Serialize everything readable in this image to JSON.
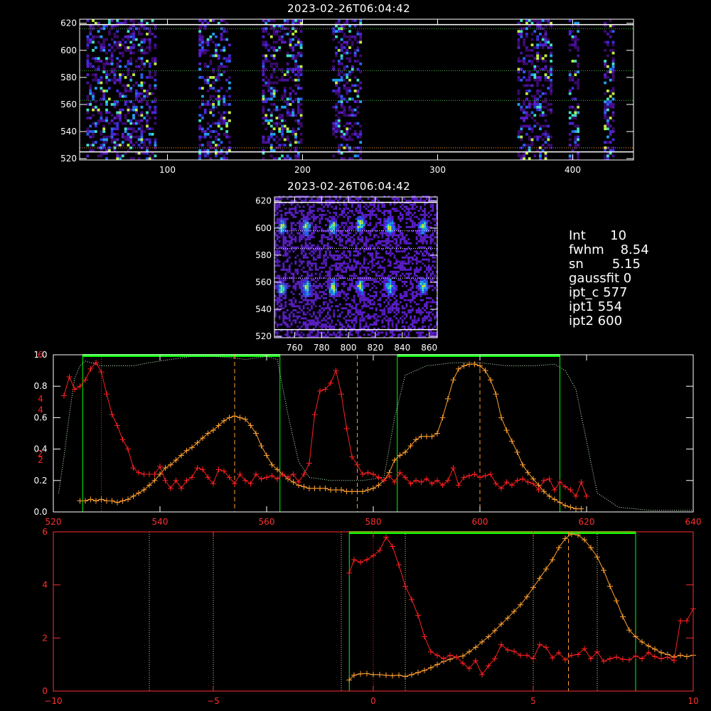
{
  "timestamp_top": "2023-02-26T06:04:42",
  "timestamp_mid": "2023-02-26T06:04:42",
  "info": [
    {
      "key": "Int",
      "val": "10"
    },
    {
      "key": "fwhm",
      "val": "8.54"
    },
    {
      "key": "sn",
      "val": "5.15"
    },
    {
      "key": "gaussfit",
      "val": "0"
    },
    {
      "key": "ipt_c",
      "val": "577"
    },
    {
      "key": "ipt1",
      "val": "554"
    },
    {
      "key": "ipt2",
      "val": "600"
    }
  ],
  "colors": {
    "background": "#000000",
    "axis": "#ffffff",
    "red": "#ff2020",
    "orange": "#ffa030",
    "green": "#00ff00",
    "lightgreen": "#c8ffc8",
    "grid_dotted_green": "#40c040",
    "grid_dotted_yellow": "#d8d890",
    "bottom_axis": "#ff3030"
  },
  "chart_data": [
    {
      "type": "heatmap",
      "title": "2023-02-26T06:04:42",
      "xlim": [
        35,
        445
      ],
      "ylim": [
        519,
        623
      ],
      "xticks": [
        100,
        200,
        300,
        400
      ],
      "yticks": [
        520,
        540,
        560,
        580,
        600,
        620
      ],
      "bands_x": [
        [
          40,
          92
        ],
        [
          123,
          146
        ],
        [
          170,
          200
        ],
        [
          222,
          243
        ],
        [
          359,
          384
        ],
        [
          397,
          405
        ],
        [
          423,
          430
        ]
      ],
      "hlines_white": [
        525,
        619
      ],
      "hlines_green_dotted": [
        563,
        585,
        616
      ],
      "hlines_orange_dotted": [
        528
      ]
    },
    {
      "type": "heatmap",
      "title": "2023-02-26T06:04:42",
      "xlim": [
        745,
        866
      ],
      "ylim": [
        519,
        623
      ],
      "xticks": [
        760,
        780,
        800,
        820,
        840,
        860
      ],
      "yticks": [
        520,
        540,
        560,
        580,
        600,
        620
      ],
      "spots": [
        [
          750,
          600
        ],
        [
          768,
          600
        ],
        [
          788,
          600
        ],
        [
          808,
          602
        ],
        [
          830,
          600
        ],
        [
          855,
          600
        ],
        [
          750,
          555
        ],
        [
          768,
          555
        ],
        [
          788,
          555
        ],
        [
          808,
          556
        ],
        [
          830,
          556
        ],
        [
          855,
          556
        ]
      ],
      "hlines": [
        525,
        619,
        563,
        585,
        598
      ]
    },
    {
      "type": "line",
      "xlim": [
        520,
        640
      ],
      "ylim": [
        0,
        1.0
      ],
      "xticks": [
        520,
        540,
        560,
        580,
        600,
        620,
        640
      ],
      "yticks_left": [
        "0.0",
        "0.2",
        "0.4",
        "0.6",
        "0.8",
        "1.0"
      ],
      "yticks_red": [
        "2",
        "2",
        "4",
        "4",
        "6"
      ],
      "green_boxes": [
        [
          525.5,
          562.5
        ],
        [
          584.5,
          615
        ]
      ],
      "vlines_orange_dashed": [
        554,
        577,
        600
      ],
      "vline_red_dotted": [
        529
      ],
      "series": [
        {
          "x": [
            521,
            522,
            523,
            524,
            525,
            526,
            527,
            528,
            529,
            530,
            532,
            535,
            538,
            542,
            546,
            550,
            554,
            556,
            558,
            560,
            562,
            564,
            566,
            568,
            572,
            576,
            578,
            580,
            582,
            584,
            586,
            590,
            595,
            600,
            605,
            610,
            614,
            616,
            618,
            620,
            622,
            626,
            632,
            640
          ],
          "values": [
            0.12,
            0.35,
            0.62,
            0.85,
            0.93,
            0.96,
            0.95,
            0.94,
            0.93,
            0.93,
            0.93,
            0.93,
            0.95,
            0.97,
            0.99,
            0.99,
            0.98,
            0.97,
            0.98,
            0.99,
            0.97,
            0.62,
            0.32,
            0.22,
            0.2,
            0.2,
            0.2,
            0.21,
            0.22,
            0.6,
            0.87,
            0.93,
            0.95,
            0.95,
            0.93,
            0.93,
            0.94,
            0.9,
            0.78,
            0.45,
            0.12,
            0.03,
            0.01,
            0.01
          ]
        },
        {
          "x": [
            525,
            526,
            527,
            528,
            529,
            530,
            531,
            532,
            533,
            534,
            535,
            536,
            537,
            538,
            539,
            540,
            541,
            542,
            543,
            544,
            545,
            546,
            547,
            548,
            549,
            550,
            551,
            552,
            553,
            554,
            555,
            556,
            557,
            558,
            559,
            560,
            561,
            562,
            563,
            564,
            565,
            566,
            567,
            568,
            569,
            570,
            571,
            572,
            573,
            574,
            575,
            576,
            577,
            578,
            579,
            580,
            581,
            582,
            583,
            584,
            585,
            586,
            587,
            588,
            589,
            590,
            591,
            592,
            593,
            594,
            595,
            596,
            597,
            598,
            599,
            600,
            601,
            602,
            603,
            604,
            605,
            606,
            607,
            608,
            609,
            610,
            611,
            612,
            613,
            614,
            615,
            616,
            617,
            618,
            619
          ],
          "values": [
            0.07,
            0.07,
            0.08,
            0.07,
            0.08,
            0.07,
            0.07,
            0.06,
            0.07,
            0.08,
            0.1,
            0.12,
            0.14,
            0.17,
            0.2,
            0.24,
            0.28,
            0.3,
            0.33,
            0.36,
            0.39,
            0.41,
            0.44,
            0.47,
            0.5,
            0.52,
            0.55,
            0.58,
            0.6,
            0.61,
            0.6,
            0.59,
            0.55,
            0.5,
            0.42,
            0.36,
            0.3,
            0.27,
            0.24,
            0.21,
            0.19,
            0.17,
            0.16,
            0.15,
            0.15,
            0.15,
            0.15,
            0.14,
            0.14,
            0.14,
            0.13,
            0.13,
            0.13,
            0.13,
            0.14,
            0.15,
            0.17,
            0.2,
            0.25,
            0.33,
            0.36,
            0.38,
            0.42,
            0.46,
            0.48,
            0.48,
            0.48,
            0.5,
            0.6,
            0.72,
            0.84,
            0.91,
            0.93,
            0.94,
            0.94,
            0.93,
            0.9,
            0.84,
            0.75,
            0.6,
            0.52,
            0.45,
            0.38,
            0.3,
            0.25,
            0.21,
            0.17,
            0.13,
            0.1,
            0.08,
            0.06,
            0.04,
            0.03,
            0.02,
            0.02
          ]
        },
        {
          "x": [
            522,
            523,
            524,
            525,
            526,
            527,
            528,
            529,
            530,
            531,
            532,
            533,
            534,
            535,
            536,
            537,
            538,
            539,
            540,
            541,
            542,
            543,
            544,
            545,
            546,
            547,
            548,
            549,
            550,
            551,
            552,
            553,
            554,
            555,
            556,
            557,
            558,
            559,
            560,
            561,
            562,
            563,
            564,
            565,
            566,
            567,
            568,
            569,
            570,
            571,
            572,
            573,
            574,
            575,
            576,
            577,
            578,
            579,
            580,
            581,
            582,
            583,
            584,
            585,
            586,
            587,
            588,
            589,
            590,
            591,
            592,
            593,
            594,
            595,
            596,
            597,
            598,
            599,
            600,
            601,
            602,
            603,
            604,
            605,
            606,
            607,
            608,
            609,
            610,
            611,
            612,
            613,
            614,
            615,
            616,
            617,
            618,
            619,
            620
          ],
          "values": [
            0.74,
            0.86,
            0.78,
            0.8,
            0.84,
            0.91,
            0.95,
            0.89,
            0.75,
            0.62,
            0.55,
            0.46,
            0.4,
            0.28,
            0.25,
            0.24,
            0.24,
            0.24,
            0.29,
            0.2,
            0.15,
            0.2,
            0.15,
            0.2,
            0.22,
            0.28,
            0.27,
            0.22,
            0.18,
            0.27,
            0.26,
            0.22,
            0.18,
            0.24,
            0.2,
            0.18,
            0.24,
            0.21,
            0.22,
            0.23,
            0.21,
            0.24,
            0.22,
            0.24,
            0.19,
            0.24,
            0.31,
            0.62,
            0.77,
            0.78,
            0.82,
            0.9,
            0.75,
            0.53,
            0.35,
            0.3,
            0.24,
            0.25,
            0.24,
            0.22,
            0.2,
            0.23,
            0.19,
            0.25,
            0.22,
            0.18,
            0.2,
            0.19,
            0.21,
            0.18,
            0.2,
            0.17,
            0.2,
            0.28,
            0.17,
            0.22,
            0.23,
            0.24,
            0.22,
            0.23,
            0.24,
            0.18,
            0.15,
            0.19,
            0.17,
            0.2,
            0.21,
            0.19,
            0.18,
            0.14,
            0.2,
            0.21,
            0.14,
            0.19,
            0.16,
            0.14,
            0.1,
            0.19,
            0.1
          ]
        }
      ]
    },
    {
      "type": "line",
      "xlim": [
        -10,
        10
      ],
      "ylim": [
        0,
        6
      ],
      "xticks": [
        -10,
        -5,
        0,
        5,
        10
      ],
      "yticks": [
        0,
        2,
        4,
        6
      ],
      "green_box": [
        -0.75,
        8.2
      ],
      "vlines_dotted_yellow": [
        -7,
        -5,
        -1,
        1,
        5,
        7
      ],
      "vline_red_dotted": [
        0
      ],
      "vline_orange_dashed": [
        6.1
      ],
      "series": [
        {
          "x": [
            -0.75,
            -0.6,
            -0.4,
            -0.2,
            0.0,
            0.2,
            0.4,
            0.6,
            0.8,
            1.0,
            1.2,
            1.4,
            1.6,
            1.8,
            2.0,
            2.2,
            2.4,
            2.6,
            2.8,
            3.0,
            3.2,
            3.4,
            3.6,
            3.8,
            4.0,
            4.2,
            4.4,
            4.6,
            4.8,
            5.0,
            5.2,
            5.4,
            5.6,
            5.8,
            6.0,
            6.2,
            6.4,
            6.6,
            6.8,
            7.0,
            7.2,
            7.4,
            7.6,
            7.8,
            8.0,
            8.2,
            8.4,
            8.6,
            8.8,
            9.0,
            9.2,
            9.4,
            9.6,
            9.8,
            10.0
          ],
          "values": [
            0.42,
            0.6,
            0.65,
            0.66,
            0.62,
            0.62,
            0.6,
            0.58,
            0.6,
            0.55,
            0.62,
            0.7,
            0.78,
            0.88,
            1.0,
            1.12,
            1.2,
            1.28,
            1.32,
            1.48,
            1.65,
            1.85,
            2.05,
            2.28,
            2.52,
            2.75,
            3.0,
            3.25,
            3.55,
            3.9,
            4.25,
            4.6,
            4.95,
            5.4,
            5.75,
            5.92,
            5.88,
            5.7,
            5.4,
            5.05,
            4.55,
            3.95,
            3.4,
            2.8,
            2.3,
            2.05,
            1.85,
            1.7,
            1.58,
            1.45,
            1.38,
            1.28,
            1.35,
            1.3,
            1.35
          ]
        },
        {
          "x": [
            -0.75,
            -0.6,
            -0.4,
            -0.2,
            0.0,
            0.2,
            0.4,
            0.6,
            0.8,
            1.0,
            1.2,
            1.4,
            1.6,
            1.8,
            2.0,
            2.2,
            2.4,
            2.6,
            2.8,
            3.0,
            3.2,
            3.4,
            3.6,
            3.8,
            4.0,
            4.2,
            4.4,
            4.6,
            4.8,
            5.0,
            5.2,
            5.4,
            5.6,
            5.8,
            6.0,
            6.2,
            6.4,
            6.6,
            6.8,
            7.0,
            7.2,
            7.4,
            7.6,
            7.8,
            8.0,
            8.2,
            8.4,
            8.6,
            8.8,
            9.0,
            9.2,
            9.4,
            9.6,
            9.8,
            10.0
          ],
          "values": [
            4.45,
            4.95,
            4.85,
            4.95,
            5.1,
            5.3,
            5.8,
            5.45,
            4.75,
            3.95,
            3.45,
            2.85,
            2.05,
            1.48,
            1.35,
            1.22,
            1.35,
            1.28,
            1.05,
            0.85,
            1.15,
            0.62,
            0.95,
            1.22,
            1.75,
            1.55,
            1.5,
            1.35,
            1.35,
            1.22,
            1.75,
            1.65,
            1.25,
            1.45,
            1.18,
            1.35,
            1.38,
            1.6,
            1.22,
            1.48,
            1.12,
            1.22,
            1.28,
            1.2,
            1.18,
            1.32,
            1.22,
            1.45,
            1.3,
            1.22,
            1.28,
            1.15,
            2.65,
            2.65,
            3.1
          ]
        }
      ]
    }
  ]
}
